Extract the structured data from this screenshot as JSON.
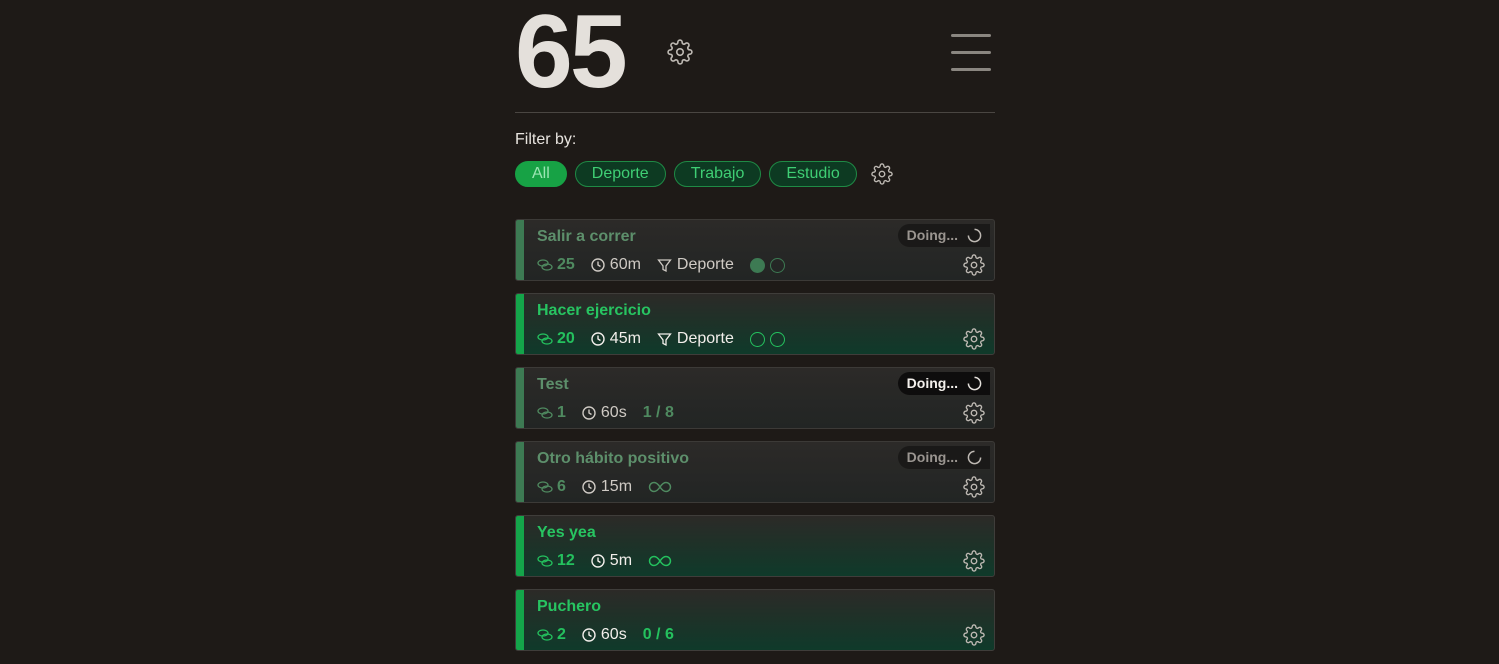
{
  "header": {
    "score": "65"
  },
  "filter": {
    "label": "Filter by:",
    "options": [
      "All",
      "Deporte",
      "Trabajo",
      "Estudio"
    ],
    "active": "All"
  },
  "habits": [
    {
      "title": "Salir a correr",
      "streak": "25",
      "time": "60m",
      "category": "Deporte",
      "status": "Doing...",
      "dots_filled": 1,
      "dots_total": 2
    },
    {
      "title": "Hacer ejercicio",
      "streak": "20",
      "time": "45m",
      "category": "Deporte",
      "dots_filled": 0,
      "dots_total": 2
    },
    {
      "title": "Test",
      "streak": "1",
      "time": "60s",
      "progress": "1 / 8",
      "status": "Doing..."
    },
    {
      "title": "Otro hábito positivo",
      "streak": "6",
      "time": "15m",
      "repeat": "infinite-icon",
      "status": "Doing..."
    },
    {
      "title": "Yes yea",
      "streak": "12",
      "time": "5m",
      "repeat": "infinite-icon"
    },
    {
      "title": "Puchero",
      "streak": "2",
      "time": "60s",
      "progress": "0 / 6"
    }
  ],
  "colors": {
    "accent": "#17a245",
    "background": "#1e1a17",
    "muted_green": "#3d7a53"
  }
}
